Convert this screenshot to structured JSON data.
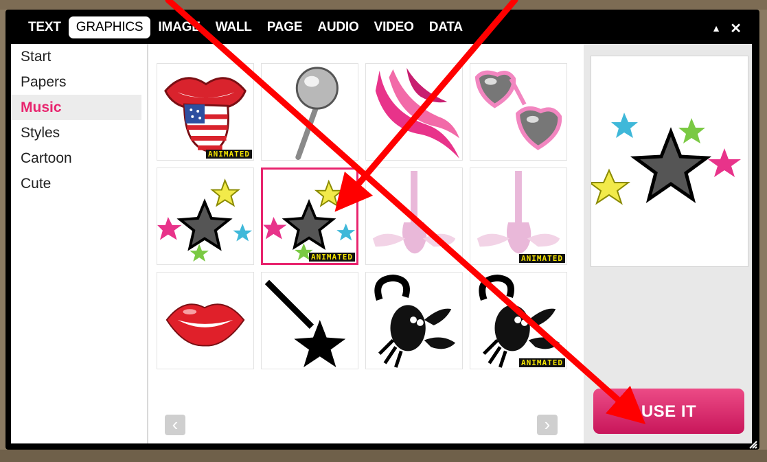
{
  "tabs": [
    {
      "label": "TEXT",
      "active": false
    },
    {
      "label": "GRAPHICS",
      "active": true
    },
    {
      "label": "IMAGE",
      "active": false
    },
    {
      "label": "WALL",
      "active": false
    },
    {
      "label": "PAGE",
      "active": false
    },
    {
      "label": "AUDIO",
      "active": false
    },
    {
      "label": "VIDEO",
      "active": false
    },
    {
      "label": "DATA",
      "active": false
    }
  ],
  "window_controls": {
    "collapse": "▲",
    "close": "✕"
  },
  "sidebar": {
    "items": [
      {
        "label": "Start"
      },
      {
        "label": "Papers"
      },
      {
        "label": "Music",
        "active": true
      },
      {
        "label": "Styles"
      },
      {
        "label": "Cartoon"
      },
      {
        "label": "Cute"
      }
    ]
  },
  "grid": {
    "items": [
      {
        "icon": "rolling-stones-tongue-icon",
        "badge": "ANIMATED"
      },
      {
        "icon": "silver-lollipop-icon"
      },
      {
        "icon": "pink-hair-icon"
      },
      {
        "icon": "heart-sunglasses-icon"
      },
      {
        "icon": "shooting-stars-icon"
      },
      {
        "icon": "shooting-stars-icon",
        "badge": "ANIMATED",
        "selected": true
      },
      {
        "icon": "winged-guitar-icon"
      },
      {
        "icon": "winged-guitar-icon",
        "badge": "ANIMATED"
      },
      {
        "icon": "red-lips-icon"
      },
      {
        "icon": "star-guitar-icon"
      },
      {
        "icon": "scorpion-icon"
      },
      {
        "icon": "scorpion-icon",
        "badge": "ANIMATED"
      }
    ],
    "prev": "‹",
    "next": "›"
  },
  "preview": {
    "icon": "shooting-stars-icon"
  },
  "use_button": {
    "label": "USE IT"
  },
  "colors": {
    "accent": "#e8246e",
    "annotation_arrow": "#ff0000",
    "window_bg": "#000000",
    "badge_text": "#f4e300"
  }
}
